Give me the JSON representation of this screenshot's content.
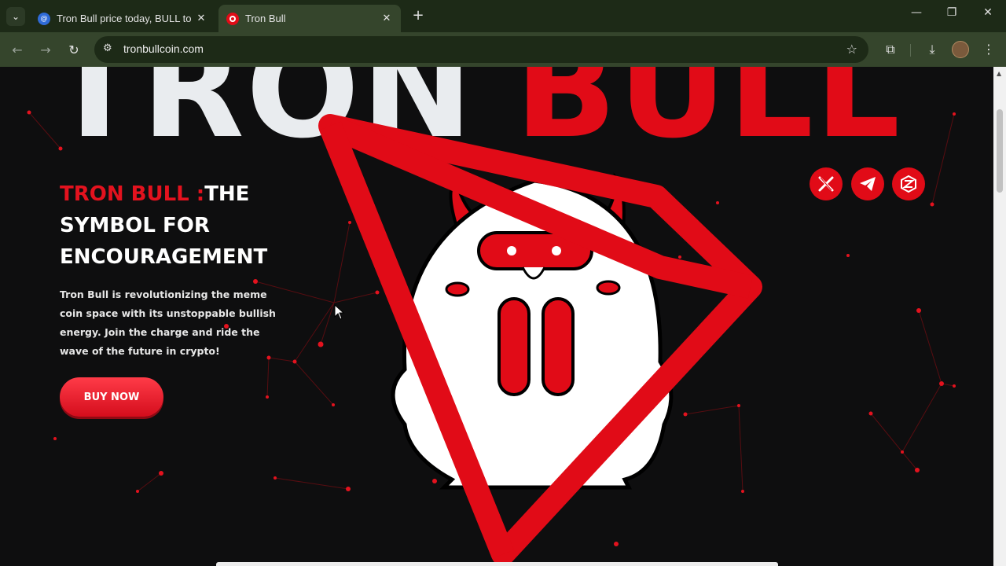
{
  "browser": {
    "tabs": [
      {
        "title": "Tron Bull price today, BULL to USD",
        "active": false,
        "favicon": "coin-site-icon"
      },
      {
        "title": "Tron Bull",
        "active": true,
        "favicon": "tron-bull-icon"
      }
    ],
    "address": "tronbullcoin.com"
  },
  "hero": {
    "headline_left": "TRON",
    "headline_right": "BULL",
    "title_accent": "TRON BULL :",
    "title_rest": "THE SYMBOL FOR ENCOURAGEMENT",
    "description": "Tron Bull is revolutionizing the meme coin space with its unstoppable bullish energy. Join the charge and ride the wave of the future in crypto!",
    "cta_label": "BUY NOW"
  },
  "social": [
    {
      "name": "x-icon"
    },
    {
      "name": "telegram-icon"
    },
    {
      "name": "dextools-icon"
    }
  ],
  "colors": {
    "accent": "#e10b17",
    "background": "#0e0e0f",
    "chrome": "#35452c"
  }
}
